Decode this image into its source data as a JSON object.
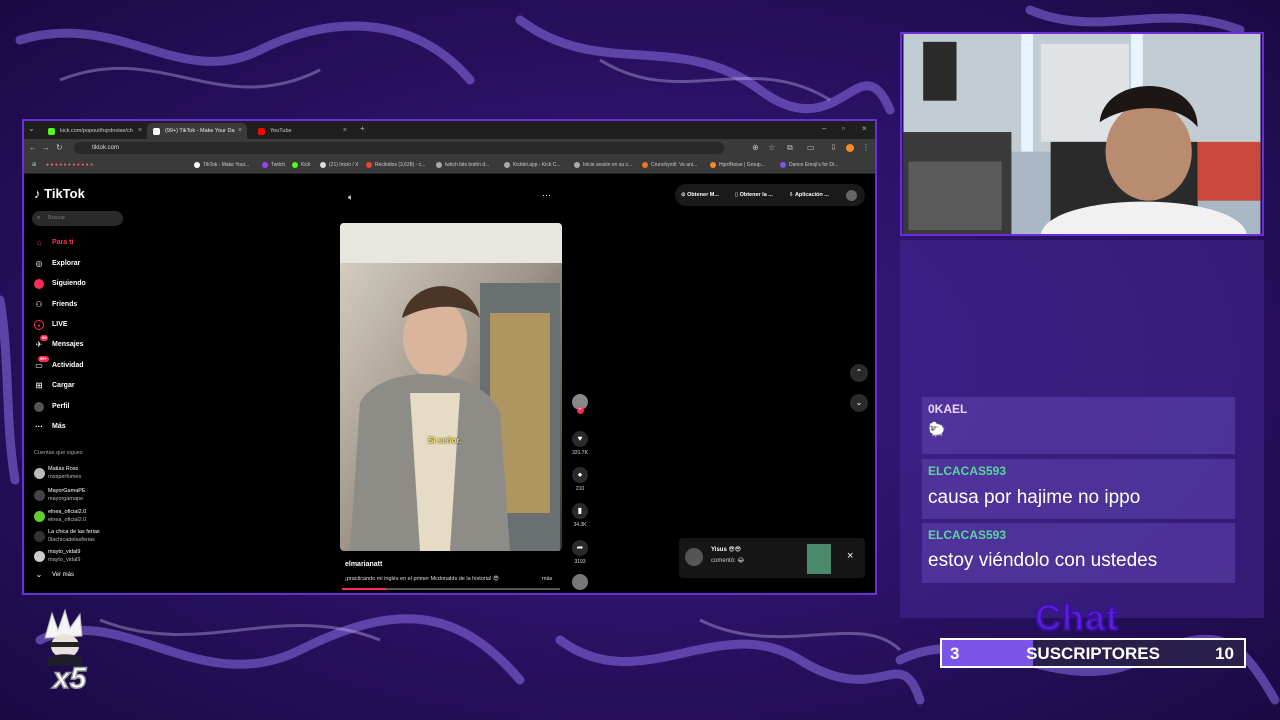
{
  "colors": {
    "accent": "#6a2fd8",
    "tiktok_red": "#fe2c55",
    "chat_user_1": "#e8d8ff",
    "chat_user_2": "#5bd6a0"
  },
  "browser": {
    "tabs": [
      {
        "label": "kick.com/popout/hqrdnoise/ch",
        "icon": "kick-icon"
      },
      {
        "label": "(99+) TikTok - Make Your Da",
        "icon": "tiktok-icon"
      },
      {
        "label": "YouTube",
        "icon": "youtube-icon"
      }
    ],
    "url": "tiktok.com",
    "bookmarks": [
      "TikTok - Make Your...",
      "Twitch",
      "Kick",
      "(21) Inicio / X",
      "Recibidos (3,628) - c...",
      "twitch bits botón d...",
      "Kicklet.app - Kick C...",
      "Inicie sesión en su c...",
      "Crunchyroll: Ve ani...",
      "HqrdNoise | Group...",
      "Dance Emoji's for Di..."
    ]
  },
  "tiktok": {
    "logo": "TikTok",
    "search_placeholder": "Buscar",
    "nav": [
      {
        "label": "Para ti",
        "icon": "home-icon"
      },
      {
        "label": "Explorar",
        "icon": "compass-icon"
      },
      {
        "label": "Siguiendo",
        "icon": "following-icon"
      },
      {
        "label": "Friends",
        "icon": "friends-icon"
      },
      {
        "label": "LIVE",
        "icon": "live-icon"
      },
      {
        "label": "Mensajes",
        "icon": "messages-icon",
        "badge": "99"
      },
      {
        "label": "Actividad",
        "icon": "activity-icon",
        "badge": "99+"
      },
      {
        "label": "Cargar",
        "icon": "upload-icon"
      },
      {
        "label": "Perfil",
        "icon": "profile-icon"
      },
      {
        "label": "Más",
        "icon": "more-icon"
      }
    ],
    "following_header": "Cuentas que sigues",
    "following": [
      {
        "name": "Matias Ross",
        "handle": "rossperfumes"
      },
      {
        "name": "MayorGamaPE",
        "handle": "mayorgamape"
      },
      {
        "name": "elnea_oficial2.0",
        "handle": "elnea_oficial2.0"
      },
      {
        "name": "La chica de las ferias",
        "handle": "0lachicadelasferias"
      },
      {
        "name": "mayto_vidal9",
        "handle": "mayto_vidal9"
      }
    ],
    "see_more": "Ver más",
    "top_buttons": [
      "Obtener M...",
      "Obtener la ...",
      "Aplicación ..."
    ],
    "video": {
      "subtitle": "Si señor.",
      "author": "elmarianatt",
      "description": "¡practicando mi inglés en el primer Mcdonalds de la historia! 😎",
      "more": "más",
      "progress": 0.2,
      "likes": "331.7K",
      "comments": "210",
      "saves": "34.3K",
      "shares": "3193"
    },
    "notification": {
      "user": "Yisus 😎😎",
      "text": "comentó: 😂"
    }
  },
  "chat": {
    "messages": [
      {
        "user": "0KAEL",
        "text": "🐑"
      },
      {
        "user": "ELCACAS593",
        "text": "causa por hajime no ippo"
      },
      {
        "user": "ELCACAS593",
        "text": "estoy viéndolo con ustedes"
      }
    ],
    "title": "Chat"
  },
  "subs": {
    "current": "3",
    "label": "SUSCRIPTORES",
    "goal": "10",
    "progress": 0.3
  },
  "multiplier": "x5"
}
